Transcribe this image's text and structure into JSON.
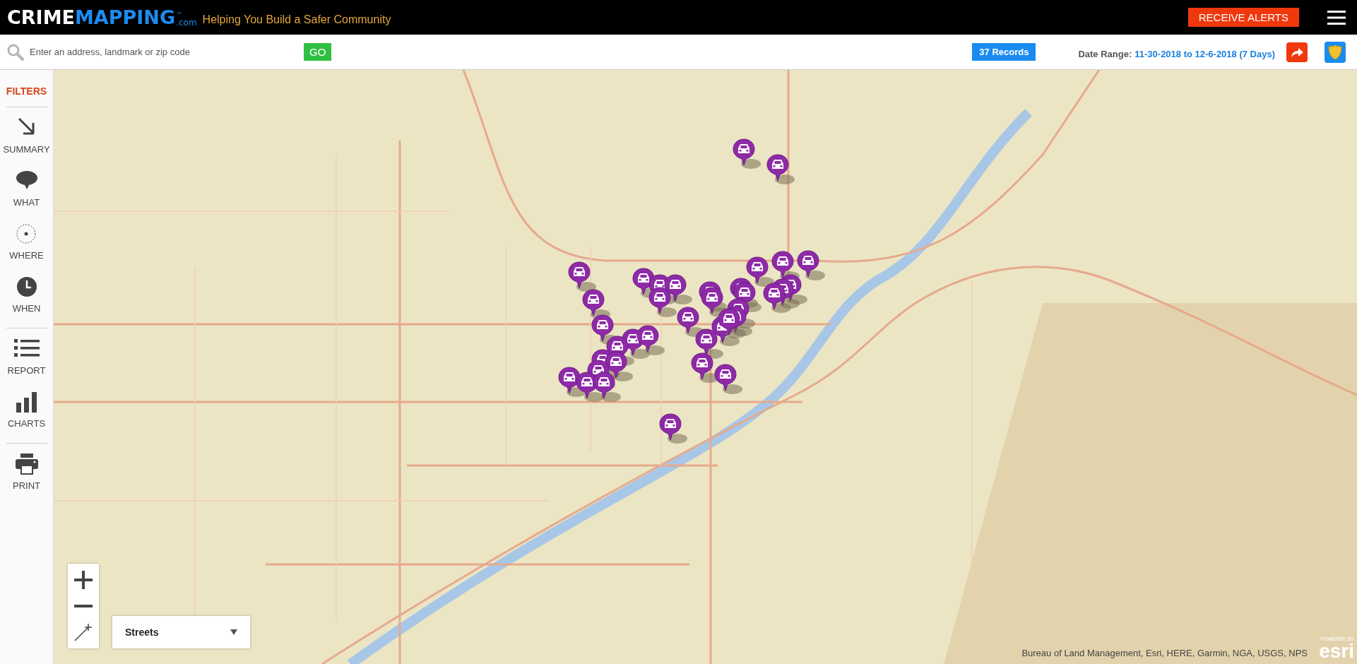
{
  "header": {
    "logo": {
      "part_1": "CRIME",
      "part_2": "MAPPING",
      "trademark": "™",
      "domain": ".com"
    },
    "tagline": "Helping You Build a Safer Community",
    "alerts_button": "RECEIVE ALERTS"
  },
  "search_bar": {
    "placeholder": "Enter an address, landmark or zip code",
    "go_button": "GO",
    "records_badge": "37 Records",
    "date_range_label": "Date Range:",
    "date_range_value": "11-30-2018 to 12-6-2018 (7 Days)"
  },
  "sidebar": {
    "title": "FILTERS",
    "sections": [
      {
        "items": [
          {
            "kind": "summary",
            "label": "SUMMARY"
          },
          {
            "kind": "what",
            "label": "WHAT"
          },
          {
            "kind": "where",
            "label": "WHERE"
          },
          {
            "kind": "when",
            "label": "WHEN"
          }
        ]
      },
      {
        "items": [
          {
            "kind": "report",
            "label": "REPORT"
          },
          {
            "kind": "charts",
            "label": "CHARTS"
          }
        ]
      },
      {
        "items": [
          {
            "kind": "print",
            "label": "PRINT"
          }
        ]
      }
    ]
  },
  "map": {
    "basemap_select": {
      "value": "Streets"
    },
    "attribution": "Bureau of Land Management, Esri, HERE, Garmin, NGA, USGS, NPS",
    "powered_by": {
      "label": "POWERED BY",
      "brand": "esri"
    }
  }
}
